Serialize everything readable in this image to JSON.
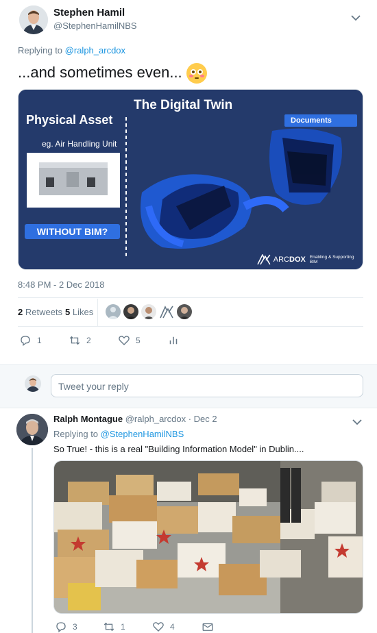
{
  "main_tweet": {
    "author_name": "Stephen Hamil",
    "author_handle": "@StephenHamilNBS",
    "replying_prefix": "Replying to",
    "replying_handle": "@ralph_arcdox",
    "text": "...and sometimes even...",
    "emoji_icon": "flushed-face-icon",
    "media": {
      "title": "The Digital Twin",
      "left_title": "Physical Asset",
      "left_subtitle": "eg. Air Handling Unit",
      "without_bim_label": "WITHOUT BIM?",
      "documents_label": "Documents",
      "brand_prefix": "ARC",
      "brand_bold": "DOX",
      "brand_tagline": "Enabling & Supporting BIM",
      "background_color": "#243a6b"
    },
    "timestamp": "8:48 PM - 2 Dec 2018",
    "retweets_count": "2",
    "retweets_label": "Retweets",
    "likes_count": "5",
    "likes_label": "Likes",
    "actions": {
      "reply": "1",
      "retweet": "2",
      "like": "5"
    }
  },
  "reply_box": {
    "placeholder": "Tweet your reply"
  },
  "reply_tweet": {
    "author_name": "Ralph Montague",
    "author_handle": "@ralph_arcdox",
    "date": "· Dec 2",
    "replying_prefix": "Replying to",
    "replying_handle": "@StephenHamilNBS",
    "text": "So True! - this is a real \"Building Information Model\" in Dublin....",
    "actions": {
      "reply": "3",
      "retweet": "1",
      "like": "4"
    }
  },
  "colors": {
    "accent": "#1b95e0",
    "muted": "#657786",
    "border": "#e6ecf0"
  }
}
